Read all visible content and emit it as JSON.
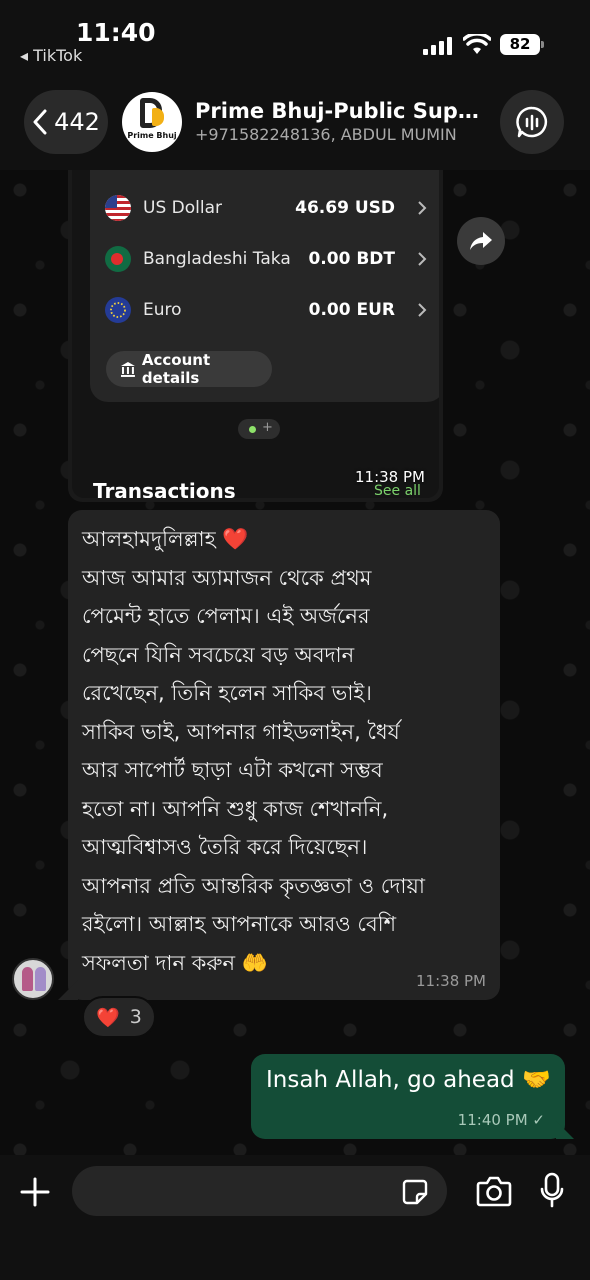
{
  "status_bar": {
    "time": "11:40",
    "back_app": "◂ TikTok",
    "battery": "82"
  },
  "header": {
    "back_count": "442",
    "avatar_text": "Prime Bhuj",
    "title": "Prime Bhuj-Public Support",
    "subtitle": "+971582248136, ABDUL MUMIN"
  },
  "image_message": {
    "accounts": [
      {
        "name": "US Dollar",
        "value": "46.69 USD",
        "flag": "us-flag-icon"
      },
      {
        "name": "Bangladeshi Taka",
        "value": "0.00 BDT",
        "flag": "bd-flag-icon"
      },
      {
        "name": "Euro",
        "value": "0.00 EUR",
        "flag": "eu-flag-icon"
      }
    ],
    "account_details_label": "Account details",
    "transactions_label": "Transactions",
    "see_all_label": "See all",
    "time": "11:38 PM"
  },
  "incoming_message": {
    "lines": [
      "আলহামদুলিল্লাহ ❤️",
      "আজ আমার অ্যামাজন থেকে প্রথম",
      "পেমেন্ট হাতে পেলাম। এই অর্জনের",
      "পেছনে যিনি সবচেয়ে বড় অবদান",
      "রেখেছেন, তিনি হলেন সাকিব ভাই।",
      "সাকিব ভাই, আপনার গাইডলাইন, ধৈর্য",
      "আর সাপোর্ট ছাড়া এটা কখনো সম্ভব",
      "হতো না। আপনি শুধু কাজ শেখাননি,",
      "আত্মবিশ্বাসও তৈরি করে দিয়েছেন।",
      "আপনার প্রতি আন্তরিক কৃতজ্ঞতা ও দোয়া",
      "রইলো। আল্লাহ আপনাকে আরও বেশি",
      "সফলতা দান করুন 🤲"
    ],
    "time": "11:38 PM",
    "reaction_emoji": "❤️",
    "reaction_count": "3"
  },
  "outgoing_message": {
    "text": "Insah Allah, go ahead 🤝",
    "time": "11:40 PM ✓"
  },
  "composer": {
    "placeholder": ""
  }
}
